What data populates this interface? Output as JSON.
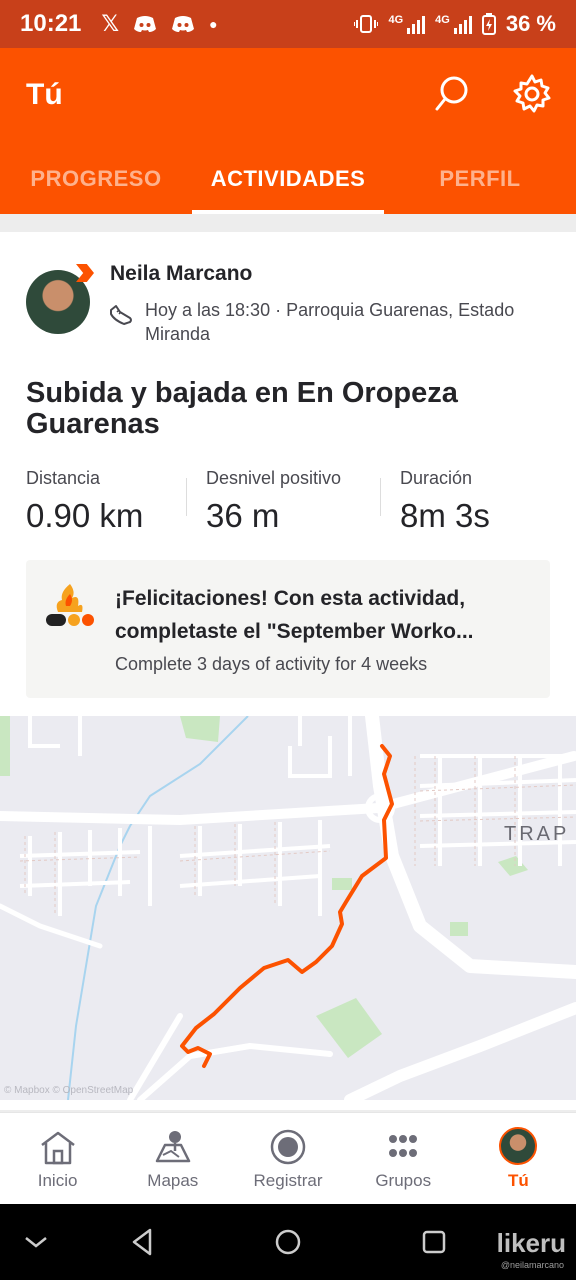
{
  "status_bar": {
    "time": "10:21",
    "battery": "36 %",
    "network_label_1": "4G",
    "network_label_2": "4G",
    "notification_icons": [
      "x-icon",
      "discord-icon",
      "discord-icon",
      "dot-icon"
    ]
  },
  "header": {
    "title": "Tú",
    "tabs": [
      {
        "label": "PROGRESO",
        "active": false
      },
      {
        "label": "ACTIVIDADES",
        "active": true
      },
      {
        "label": "PERFIL",
        "active": false
      }
    ]
  },
  "activity": {
    "athlete_name": "Neila Marcano",
    "meta": "Hoy a las 18:30 · Parroquia Guarenas, Estado Miranda",
    "title": "Subida y bajada en En Oropeza Guarenas",
    "stats": [
      {
        "label": "Distancia",
        "value": "0.90 km"
      },
      {
        "label": "Desnivel positivo",
        "value": "36 m"
      },
      {
        "label": "Duración",
        "value": "8m 3s"
      }
    ],
    "achievement": {
      "title": "¡Felicitaciones! Con esta actividad, completaste el \"September Worko...",
      "subtitle": "Complete 3 days of activity for 4 weeks"
    },
    "map": {
      "place_label": "TRAP",
      "attribution": "© Mapbox © OpenStreetMap",
      "route_color": "#fc5200"
    }
  },
  "bottom_nav": {
    "items": [
      {
        "label": "Inicio",
        "icon": "home-icon"
      },
      {
        "label": "Mapas",
        "icon": "map-icon"
      },
      {
        "label": "Registrar",
        "icon": "record-icon"
      },
      {
        "label": "Grupos",
        "icon": "groups-icon"
      },
      {
        "label": "Tú",
        "icon": "avatar",
        "active": true
      }
    ]
  },
  "watermark": {
    "text": "likeru",
    "handle": "@neilamarcano"
  },
  "colors": {
    "brand": "#fc5200",
    "status_bar": "#c8401a"
  }
}
